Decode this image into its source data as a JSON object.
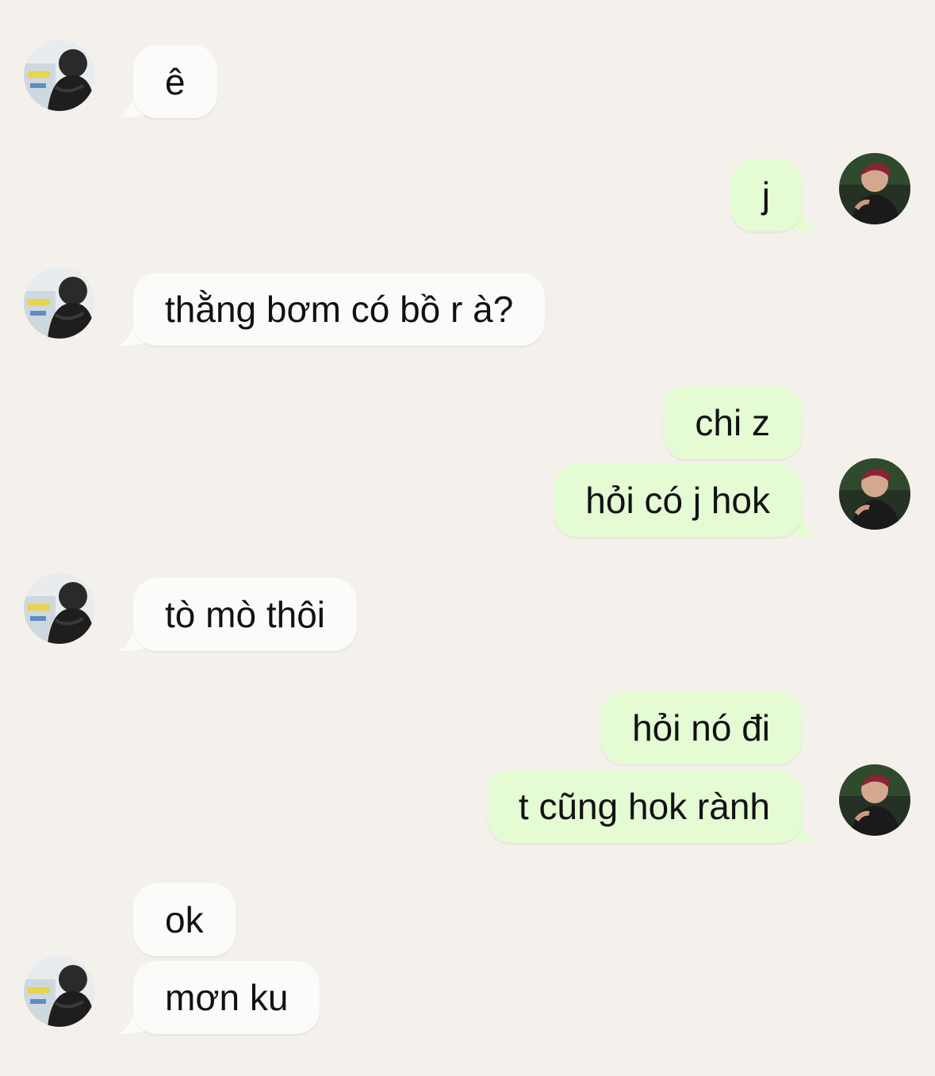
{
  "colors": {
    "background": "#f4f1ec",
    "incoming_bubble": "#fbfbfa",
    "outgoing_bubble": "#e4fbd4"
  },
  "contact_avatar": {
    "icon": "contact-avatar-photo"
  },
  "user_avatar": {
    "icon": "user-avatar-photo"
  },
  "messages": [
    {
      "direction": "incoming",
      "text": "ê"
    },
    {
      "direction": "outgoing",
      "text": "j"
    },
    {
      "direction": "incoming",
      "text": "thằng bơm có bồ r à?"
    },
    {
      "direction": "outgoing",
      "text": "chi z"
    },
    {
      "direction": "outgoing",
      "text": "hỏi có j hok"
    },
    {
      "direction": "incoming",
      "text": "tò mò thôi"
    },
    {
      "direction": "outgoing",
      "text": "hỏi nó đi"
    },
    {
      "direction": "outgoing",
      "text": "t cũng hok rành"
    },
    {
      "direction": "incoming",
      "text": "ok"
    },
    {
      "direction": "incoming",
      "text": "mơn ku"
    }
  ]
}
